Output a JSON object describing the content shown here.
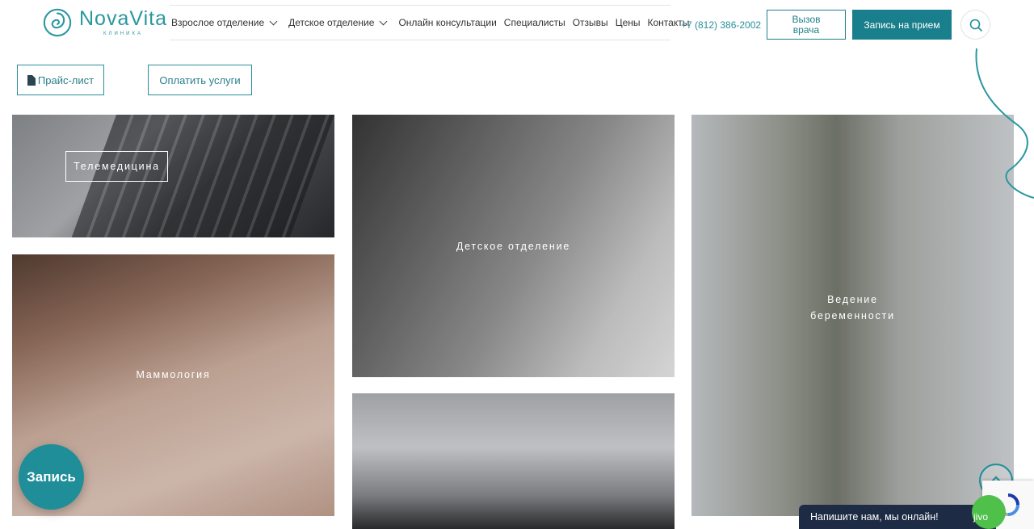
{
  "brand": {
    "name": "NovaVita",
    "sub": "КЛИНИКА",
    "color": "#2a97a0"
  },
  "nav": {
    "items": [
      {
        "label": "Взрослое отделение",
        "dropdown": true
      },
      {
        "label": "Детское отделение",
        "dropdown": true
      },
      {
        "label": "Онлайн консультации",
        "dropdown": false
      },
      {
        "label": "Специалисты",
        "dropdown": false
      },
      {
        "label": "Отзывы",
        "dropdown": false
      },
      {
        "label": "Цены",
        "dropdown": false
      },
      {
        "label": "Контакты",
        "dropdown": false
      }
    ]
  },
  "header": {
    "phone": "+7 (812) 386-2002",
    "call_doctor_line1": "Вызов",
    "call_doctor_line2": "врача",
    "book_label": "Запись на прием",
    "search_icon": "search-icon"
  },
  "actions": {
    "price_list": "Прайс-лист",
    "pay_services": "Оплатить услуги"
  },
  "tiles": {
    "telemedicine": "Телемедицина",
    "children": "Детское отделение",
    "pregnancy_line1": "Ведение",
    "pregnancy_line2": "беременности",
    "mammology": "Маммология"
  },
  "widgets": {
    "fab_label": "Запись",
    "chat_label": "Напишите нам, мы онлайн!",
    "chat_brand": "jivo"
  },
  "colors": {
    "accent": "#1a7f8c",
    "chat_bg": "#1e2b45",
    "chat_dot": "#4fc04a"
  }
}
